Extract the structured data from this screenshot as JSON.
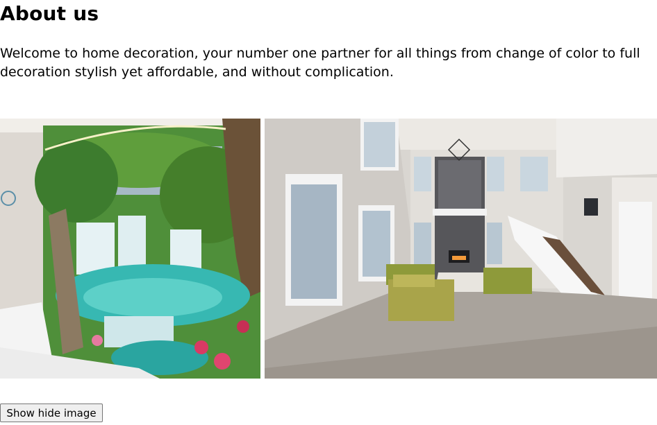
{
  "page": {
    "heading": "About us",
    "intro": "Welcome to home decoration, your number one partner for all things from change of color to full decoration stylish yet affordable, and without complication."
  },
  "gallery": {
    "images": [
      {
        "alt": "waterfall-tapestry-bedroom"
      },
      {
        "alt": "modern-living-room-interior"
      }
    ]
  },
  "controls": {
    "toggle_label": "Show hide image"
  }
}
